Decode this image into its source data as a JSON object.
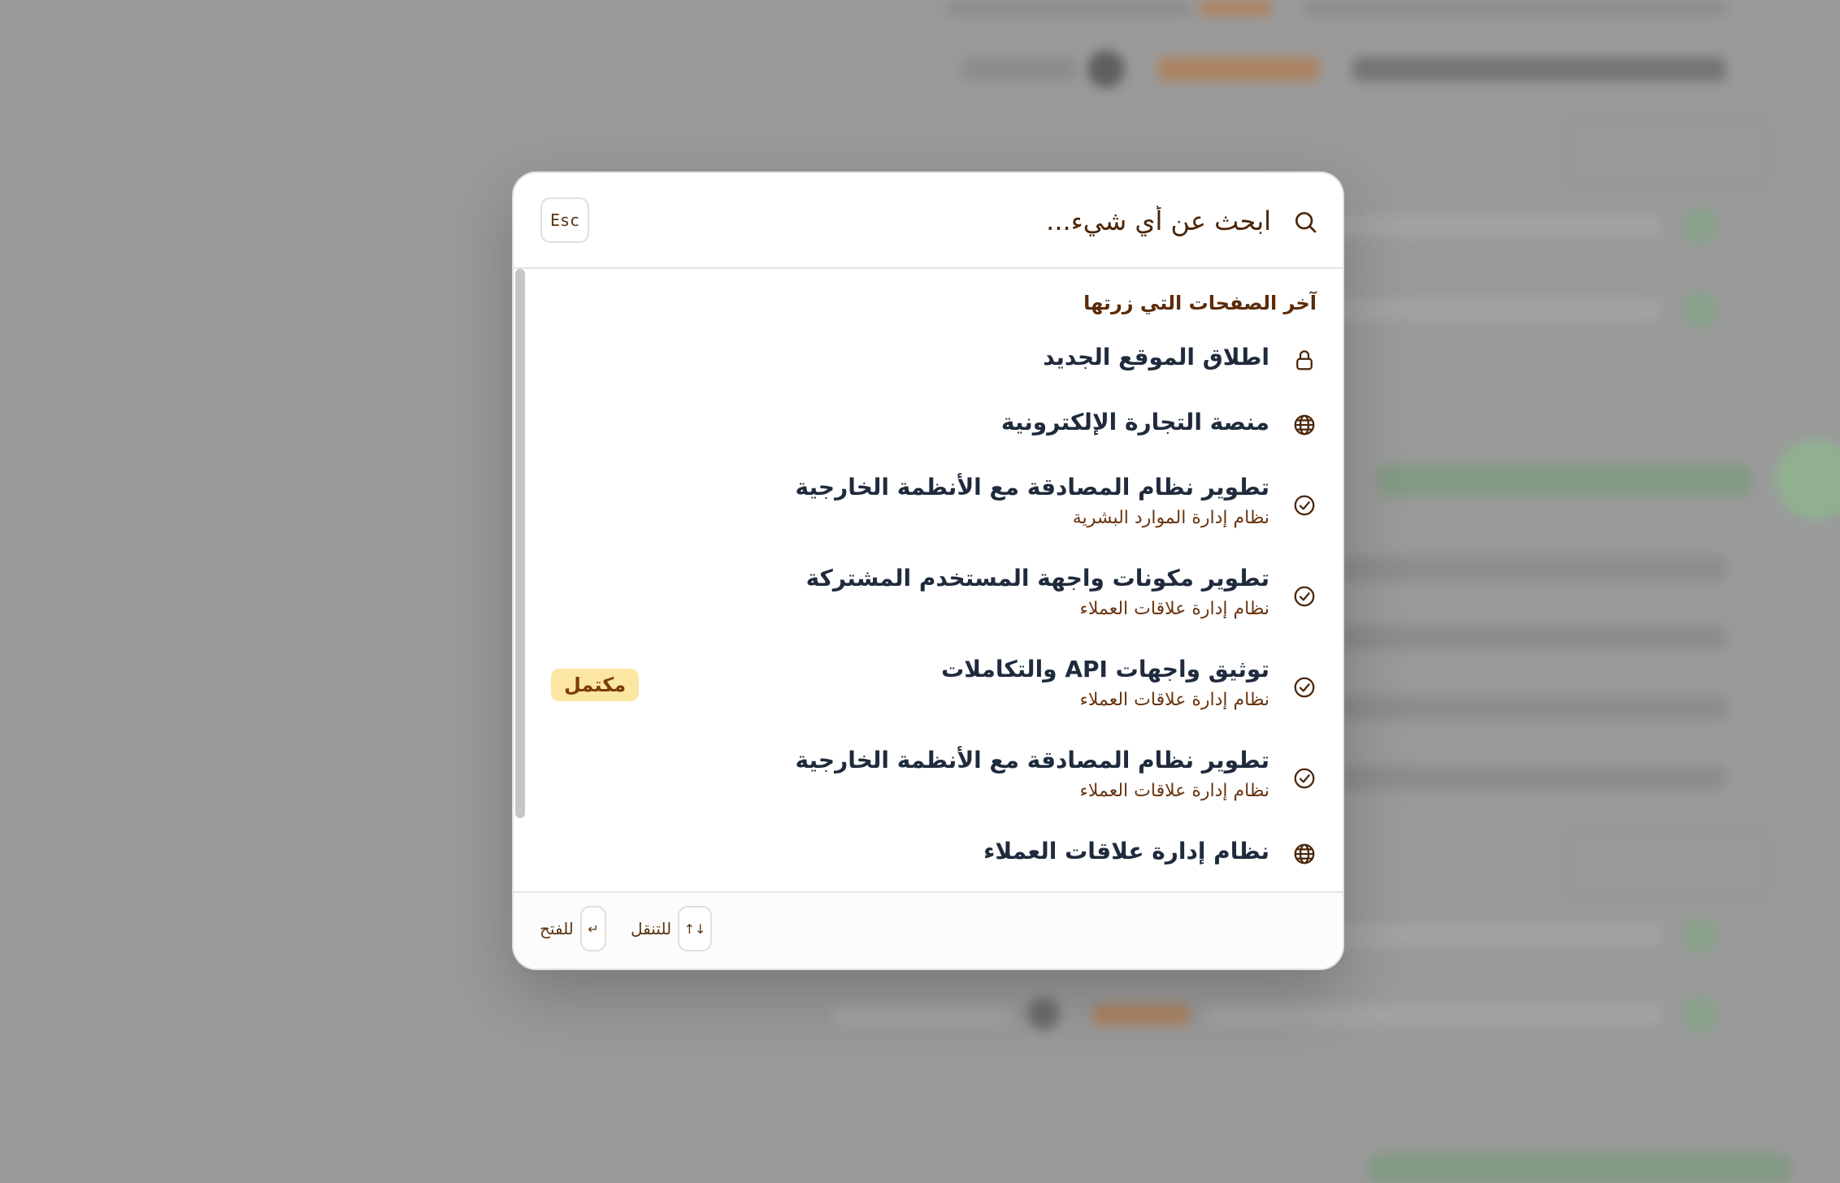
{
  "search": {
    "placeholder": "ابحث عن أي شيء...",
    "esc_label": "Esc"
  },
  "recent": {
    "heading": "آخر الصفحات التي زرتها",
    "items": [
      {
        "title": "اطلاق الموقع الجديد",
        "subtitle": "",
        "icon": "lock-icon",
        "badge": ""
      },
      {
        "title": "منصة التجارة الإلكترونية",
        "subtitle": "",
        "icon": "globe-icon",
        "badge": ""
      },
      {
        "title": "تطوير نظام المصادقة مع الأنظمة الخارجية",
        "subtitle": "نظام إدارة الموارد البشرية",
        "icon": "check-circle-icon",
        "badge": ""
      },
      {
        "title": "تطوير مكونات واجهة المستخدم المشتركة",
        "subtitle": "نظام إدارة علاقات العملاء",
        "icon": "check-circle-icon",
        "badge": ""
      },
      {
        "title": "توثيق واجهات API والتكاملات",
        "subtitle": "نظام إدارة علاقات العملاء",
        "icon": "check-circle-icon",
        "badge": "مكتمل"
      },
      {
        "title": "تطوير نظام المصادقة مع الأنظمة الخارجية",
        "subtitle": "نظام إدارة علاقات العملاء",
        "icon": "check-circle-icon",
        "badge": ""
      },
      {
        "title": "نظام إدارة علاقات العملاء",
        "subtitle": "",
        "icon": "globe-icon",
        "badge": ""
      }
    ]
  },
  "footer": {
    "navigate_keys": "↓↑",
    "navigate_label": "للتنقل",
    "open_key": "↵",
    "open_label": "للفتح"
  },
  "colors": {
    "accent_text": "#4a2508",
    "title_text": "#1f2b3d",
    "badge_bg": "#fbe6a2",
    "badge_text": "#7b3d0a",
    "overlay": "#9a9a9a"
  }
}
